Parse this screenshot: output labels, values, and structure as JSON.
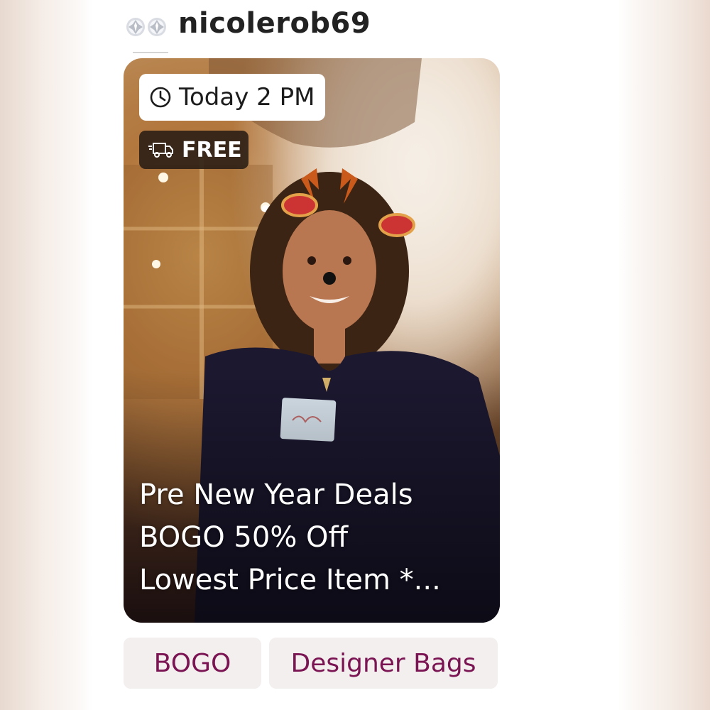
{
  "header": {
    "username": "nicolerob69",
    "avatar_icon": "diamond-earrings-icon"
  },
  "show": {
    "time_badge": {
      "icon": "clock-icon",
      "label": "Today 2 PM"
    },
    "shipping_badge": {
      "icon": "truck-icon",
      "label": "FREE"
    },
    "title_lines": [
      "Pre New Year Deals",
      "BOGO 50% Off",
      "Lowest Price Item *..."
    ]
  },
  "tags": [
    {
      "label": "BOGO"
    },
    {
      "label": "Designer Bags"
    }
  ],
  "colors": {
    "tag_text": "#7a1452",
    "tag_background": "#f3efee",
    "username": "#222222",
    "shipping_badge_bg": "#281c14"
  }
}
